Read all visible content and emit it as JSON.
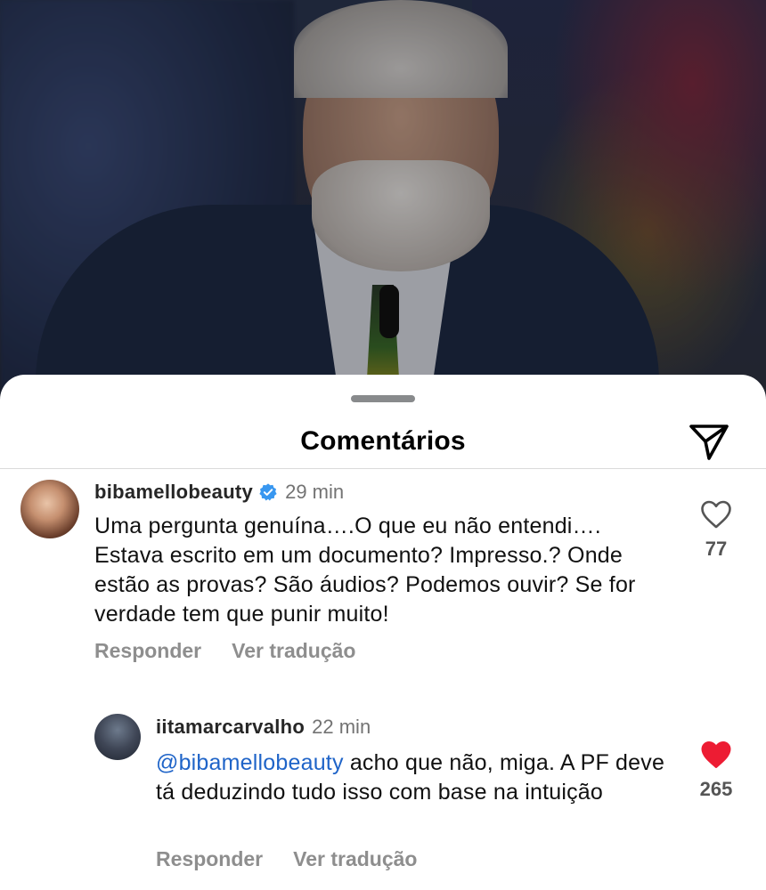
{
  "sheet": {
    "title": "Comentários"
  },
  "comments": [
    {
      "username": "bibamellobeauty",
      "verified": true,
      "time": "29 min",
      "mention": "",
      "text": "Uma pergunta genuína….O que eu não entendi…. Estava escrito em um documento? Impresso.? Onde estão as provas? São áudios? Podemos ouvir? Se for verdade tem que punir muito!",
      "likes": "77",
      "liked": false,
      "reply_label": "Responder",
      "translate_label": "Ver tradução"
    },
    {
      "username": "iitamarcarvalho",
      "verified": false,
      "time": "22 min",
      "mention": "@bibamellobeauty",
      "text": "acho que não, miga. A PF deve tá deduzindo tudo isso com base na intuição",
      "likes": "265",
      "liked": true,
      "reply_label": "Responder",
      "translate_label": "Ver tradução"
    }
  ],
  "colors": {
    "like_active": "#ed1c33",
    "verified": "#3897f0",
    "mention": "#1f64c8"
  },
  "icons": {
    "share": "paper-plane-icon",
    "like": "heart-icon",
    "verified": "verified-badge-icon"
  }
}
